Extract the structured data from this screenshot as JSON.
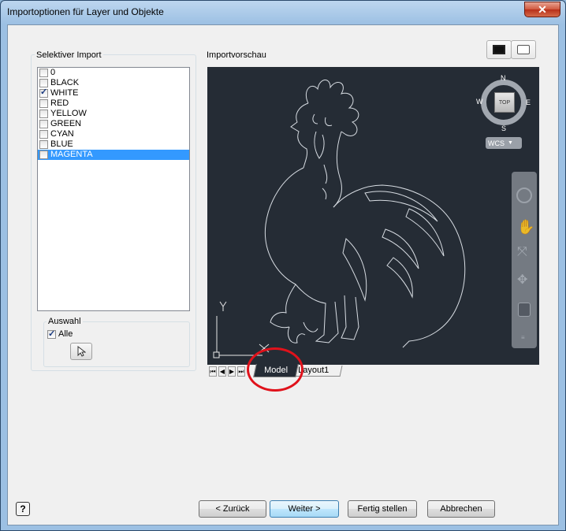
{
  "window": {
    "title": "Importoptionen für Layer und Objekte",
    "close_label": "✕"
  },
  "selective": {
    "label": "Selektiver Import",
    "layers": [
      {
        "name": "0",
        "checked": false,
        "selected": false
      },
      {
        "name": "BLACK",
        "checked": false,
        "selected": false
      },
      {
        "name": "WHITE",
        "checked": true,
        "selected": false
      },
      {
        "name": "RED",
        "checked": false,
        "selected": false
      },
      {
        "name": "YELLOW",
        "checked": false,
        "selected": false
      },
      {
        "name": "GREEN",
        "checked": false,
        "selected": false
      },
      {
        "name": "CYAN",
        "checked": false,
        "selected": false
      },
      {
        "name": "BLUE",
        "checked": false,
        "selected": false
      },
      {
        "name": "MAGENTA",
        "checked": false,
        "selected": true
      }
    ]
  },
  "auswahl": {
    "label": "Auswahl",
    "all_label": "Alle",
    "all_checked": true
  },
  "preview": {
    "label": "Importvorschau",
    "compass": {
      "n": "N",
      "s": "S",
      "e": "E",
      "w": "W",
      "top": "TOP"
    },
    "wcs": "WCS",
    "ucs_y": "Y",
    "tabs": [
      "Model",
      "Layout1"
    ]
  },
  "buttons": {
    "back": "< Zurück",
    "next": "Weiter >",
    "finish": "Fertig stellen",
    "cancel": "Abbrechen",
    "help": "?"
  },
  "colors": {
    "viewport_bg": "#252c35",
    "selection": "#3399ff",
    "annotation_red": "#e0121b"
  }
}
